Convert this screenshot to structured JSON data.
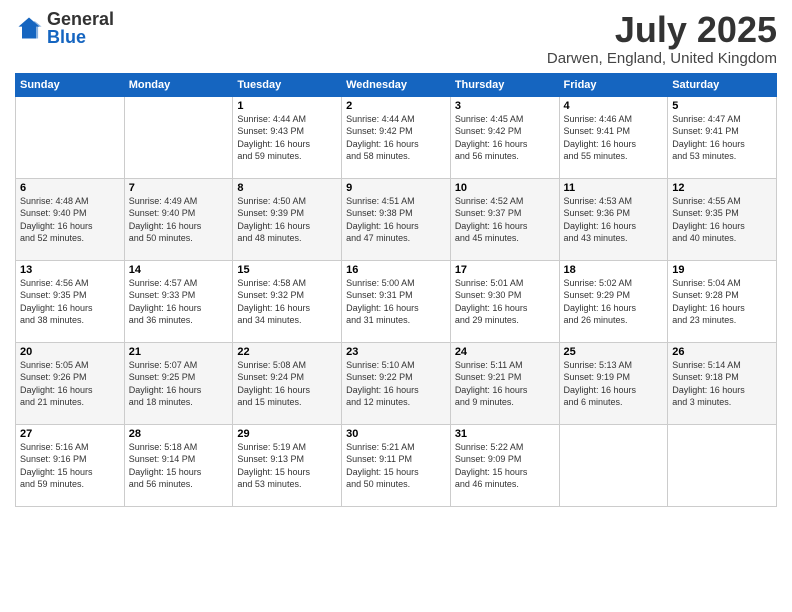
{
  "header": {
    "logo_general": "General",
    "logo_blue": "Blue",
    "month_year": "July 2025",
    "location": "Darwen, England, United Kingdom"
  },
  "weekdays": [
    "Sunday",
    "Monday",
    "Tuesday",
    "Wednesday",
    "Thursday",
    "Friday",
    "Saturday"
  ],
  "weeks": [
    [
      {
        "day": "",
        "info": ""
      },
      {
        "day": "",
        "info": ""
      },
      {
        "day": "1",
        "info": "Sunrise: 4:44 AM\nSunset: 9:43 PM\nDaylight: 16 hours\nand 59 minutes."
      },
      {
        "day": "2",
        "info": "Sunrise: 4:44 AM\nSunset: 9:42 PM\nDaylight: 16 hours\nand 58 minutes."
      },
      {
        "day": "3",
        "info": "Sunrise: 4:45 AM\nSunset: 9:42 PM\nDaylight: 16 hours\nand 56 minutes."
      },
      {
        "day": "4",
        "info": "Sunrise: 4:46 AM\nSunset: 9:41 PM\nDaylight: 16 hours\nand 55 minutes."
      },
      {
        "day": "5",
        "info": "Sunrise: 4:47 AM\nSunset: 9:41 PM\nDaylight: 16 hours\nand 53 minutes."
      }
    ],
    [
      {
        "day": "6",
        "info": "Sunrise: 4:48 AM\nSunset: 9:40 PM\nDaylight: 16 hours\nand 52 minutes."
      },
      {
        "day": "7",
        "info": "Sunrise: 4:49 AM\nSunset: 9:40 PM\nDaylight: 16 hours\nand 50 minutes."
      },
      {
        "day": "8",
        "info": "Sunrise: 4:50 AM\nSunset: 9:39 PM\nDaylight: 16 hours\nand 48 minutes."
      },
      {
        "day": "9",
        "info": "Sunrise: 4:51 AM\nSunset: 9:38 PM\nDaylight: 16 hours\nand 47 minutes."
      },
      {
        "day": "10",
        "info": "Sunrise: 4:52 AM\nSunset: 9:37 PM\nDaylight: 16 hours\nand 45 minutes."
      },
      {
        "day": "11",
        "info": "Sunrise: 4:53 AM\nSunset: 9:36 PM\nDaylight: 16 hours\nand 43 minutes."
      },
      {
        "day": "12",
        "info": "Sunrise: 4:55 AM\nSunset: 9:35 PM\nDaylight: 16 hours\nand 40 minutes."
      }
    ],
    [
      {
        "day": "13",
        "info": "Sunrise: 4:56 AM\nSunset: 9:35 PM\nDaylight: 16 hours\nand 38 minutes."
      },
      {
        "day": "14",
        "info": "Sunrise: 4:57 AM\nSunset: 9:33 PM\nDaylight: 16 hours\nand 36 minutes."
      },
      {
        "day": "15",
        "info": "Sunrise: 4:58 AM\nSunset: 9:32 PM\nDaylight: 16 hours\nand 34 minutes."
      },
      {
        "day": "16",
        "info": "Sunrise: 5:00 AM\nSunset: 9:31 PM\nDaylight: 16 hours\nand 31 minutes."
      },
      {
        "day": "17",
        "info": "Sunrise: 5:01 AM\nSunset: 9:30 PM\nDaylight: 16 hours\nand 29 minutes."
      },
      {
        "day": "18",
        "info": "Sunrise: 5:02 AM\nSunset: 9:29 PM\nDaylight: 16 hours\nand 26 minutes."
      },
      {
        "day": "19",
        "info": "Sunrise: 5:04 AM\nSunset: 9:28 PM\nDaylight: 16 hours\nand 23 minutes."
      }
    ],
    [
      {
        "day": "20",
        "info": "Sunrise: 5:05 AM\nSunset: 9:26 PM\nDaylight: 16 hours\nand 21 minutes."
      },
      {
        "day": "21",
        "info": "Sunrise: 5:07 AM\nSunset: 9:25 PM\nDaylight: 16 hours\nand 18 minutes."
      },
      {
        "day": "22",
        "info": "Sunrise: 5:08 AM\nSunset: 9:24 PM\nDaylight: 16 hours\nand 15 minutes."
      },
      {
        "day": "23",
        "info": "Sunrise: 5:10 AM\nSunset: 9:22 PM\nDaylight: 16 hours\nand 12 minutes."
      },
      {
        "day": "24",
        "info": "Sunrise: 5:11 AM\nSunset: 9:21 PM\nDaylight: 16 hours\nand 9 minutes."
      },
      {
        "day": "25",
        "info": "Sunrise: 5:13 AM\nSunset: 9:19 PM\nDaylight: 16 hours\nand 6 minutes."
      },
      {
        "day": "26",
        "info": "Sunrise: 5:14 AM\nSunset: 9:18 PM\nDaylight: 16 hours\nand 3 minutes."
      }
    ],
    [
      {
        "day": "27",
        "info": "Sunrise: 5:16 AM\nSunset: 9:16 PM\nDaylight: 15 hours\nand 59 minutes."
      },
      {
        "day": "28",
        "info": "Sunrise: 5:18 AM\nSunset: 9:14 PM\nDaylight: 15 hours\nand 56 minutes."
      },
      {
        "day": "29",
        "info": "Sunrise: 5:19 AM\nSunset: 9:13 PM\nDaylight: 15 hours\nand 53 minutes."
      },
      {
        "day": "30",
        "info": "Sunrise: 5:21 AM\nSunset: 9:11 PM\nDaylight: 15 hours\nand 50 minutes."
      },
      {
        "day": "31",
        "info": "Sunrise: 5:22 AM\nSunset: 9:09 PM\nDaylight: 15 hours\nand 46 minutes."
      },
      {
        "day": "",
        "info": ""
      },
      {
        "day": "",
        "info": ""
      }
    ]
  ]
}
